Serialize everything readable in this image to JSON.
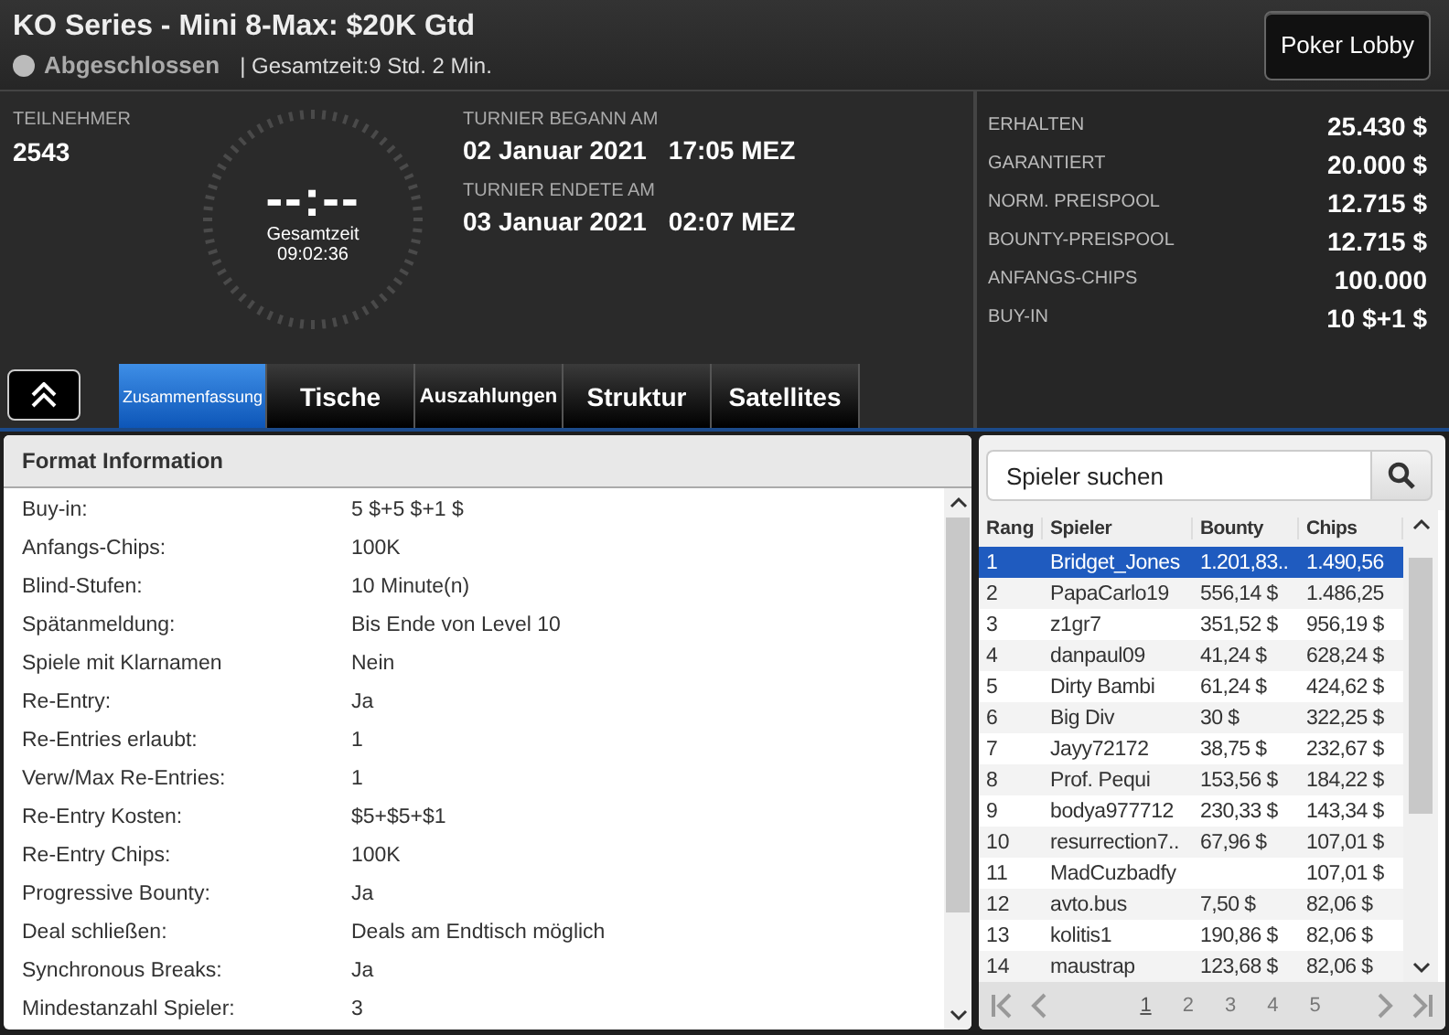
{
  "window": {
    "title": "KO Series - Mini 8-Max: $20K Gtd",
    "status": "Abgeschlossen",
    "duration": "| Gesamtzeit:9 Std.  2 Min."
  },
  "lobby_button": "Poker Lobby",
  "participants": {
    "label": "TEILNEHMER",
    "value": "2543"
  },
  "clock": {
    "display": "--:--",
    "label": "Gesamtzeit",
    "time": "09:02:36"
  },
  "dates": [
    {
      "label": "TURNIER BEGANN AM",
      "date": "02 Januar 2021",
      "time": "17:05 MEZ"
    },
    {
      "label": "TURNIER ENDETE AM",
      "date": "03 Januar 2021",
      "time": "02:07 MEZ"
    }
  ],
  "prizes": [
    {
      "label": "ERHALTEN",
      "value": "25.430 $"
    },
    {
      "label": "GARANTIERT",
      "value": "20.000 $"
    },
    {
      "label": "NORM. PREISPOOL",
      "value": "12.715 $"
    },
    {
      "label": "BOUNTY-PREISPOOL",
      "value": "12.715 $"
    },
    {
      "label": "ANFANGS-CHIPS",
      "value": "100.000"
    },
    {
      "label": "BUY-IN",
      "value": "10 $+1 $"
    }
  ],
  "tabs": [
    {
      "label": "Zusammenfassung",
      "selected": true
    },
    {
      "label": "Tische",
      "selected": false
    },
    {
      "label": "Auszahlungen",
      "selected": false
    },
    {
      "label": "Struktur",
      "selected": false
    },
    {
      "label": "Satellites",
      "selected": false
    }
  ],
  "format": {
    "title": "Format Information",
    "rows": [
      {
        "label": "Buy-in:",
        "value": "5 $+5 $+1 $"
      },
      {
        "label": "Anfangs-Chips:",
        "value": "100K"
      },
      {
        "label": "Blind-Stufen:",
        "value": "10 Minute(n)"
      },
      {
        "label": "Spätanmeldung:",
        "value": "Bis Ende von Level 10"
      },
      {
        "label": "Spiele mit Klarnamen",
        "value": "Nein"
      },
      {
        "label": "Re-Entry:",
        "value": "Ja"
      },
      {
        "label": "Re-Entries erlaubt:",
        "value": "1"
      },
      {
        "label": "Verw/Max Re-Entries:",
        "value": "1"
      },
      {
        "label": "Re-Entry Kosten:",
        "value": "$5+$5+$1"
      },
      {
        "label": "Re-Entry Chips:",
        "value": "100K"
      },
      {
        "label": "Progressive Bounty:",
        "value": "Ja"
      },
      {
        "label": "Deal schließen:",
        "value": "Deals am Endtisch möglich"
      },
      {
        "label": "Synchronous Breaks:",
        "value": "Ja"
      },
      {
        "label": "Mindestanzahl Spieler:",
        "value": "3"
      }
    ]
  },
  "players": {
    "search": {
      "placeholder": "Spieler suchen"
    },
    "columns": [
      "Rang",
      "Spieler",
      "Bounty",
      "Chips"
    ],
    "rows": [
      {
        "cells": [
          "1",
          "Bridget_Jones",
          "1.201,83..",
          "1.490,56"
        ],
        "selected": true
      },
      {
        "cells": [
          "2",
          "PapaCarlo19",
          "556,14 $",
          "1.486,25"
        ],
        "selected": false
      },
      {
        "cells": [
          "3",
          "z1gr7",
          "351,52 $",
          "956,19 $"
        ],
        "selected": false
      },
      {
        "cells": [
          "4",
          "danpaul09",
          "41,24 $",
          "628,24 $"
        ],
        "selected": false
      },
      {
        "cells": [
          "5",
          "Dirty Bambi",
          "61,24 $",
          "424,62 $"
        ],
        "selected": false
      },
      {
        "cells": [
          "6",
          "Big Div",
          "30 $",
          "322,25 $"
        ],
        "selected": false
      },
      {
        "cells": [
          "7",
          "Jayy72172",
          "38,75 $",
          "232,67 $"
        ],
        "selected": false
      },
      {
        "cells": [
          "8",
          "Prof. Pequi",
          "153,56 $",
          "184,22 $"
        ],
        "selected": false
      },
      {
        "cells": [
          "9",
          "bodya977712",
          "230,33 $",
          "143,34 $"
        ],
        "selected": false
      },
      {
        "cells": [
          "10",
          "resurrection7..",
          "67,96 $",
          "107,01 $"
        ],
        "selected": false
      },
      {
        "cells": [
          "11",
          "MadCuzbadfy",
          "",
          "107,01 $"
        ],
        "selected": false
      },
      {
        "cells": [
          "12",
          "avto.bus",
          "7,50 $",
          "82,06 $"
        ],
        "selected": false
      },
      {
        "cells": [
          "13",
          "kolitis1",
          "190,86 $",
          "82,06 $"
        ],
        "selected": false
      },
      {
        "cells": [
          "14",
          "maustrap",
          "123,68 $",
          "82,06 $"
        ],
        "selected": false
      }
    ],
    "pages": [
      {
        "label": "1",
        "selected": true
      },
      {
        "label": "2",
        "selected": false
      },
      {
        "label": "3",
        "selected": false
      },
      {
        "label": "4",
        "selected": false
      },
      {
        "label": "5",
        "selected": false
      }
    ]
  }
}
